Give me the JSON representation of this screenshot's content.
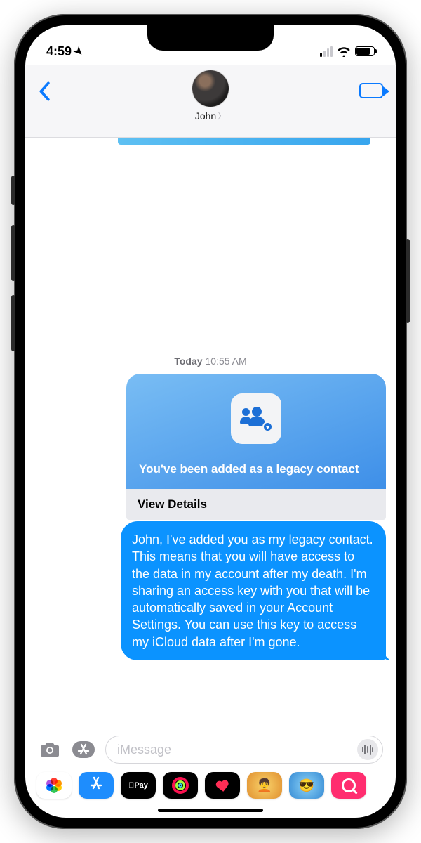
{
  "status": {
    "time": "4:59",
    "signal_active_bars": 1,
    "battery_percent": 72
  },
  "header": {
    "contact_name": "John"
  },
  "conversation": {
    "timestamp_day": "Today",
    "timestamp_time": "10:55 AM",
    "card": {
      "title": "You've been added as a legacy contact",
      "action": "View Details"
    },
    "message": "John, I've added you as my legacy contact. This means that you will have access to the data in my account after my death. I'm sharing an access key with you that will be automatically saved in your Account Settings. You can use this key to access my iCloud data after I'm gone."
  },
  "compose": {
    "placeholder": "iMessage"
  },
  "app_drawer": {
    "apple_pay_label": "Pay"
  }
}
